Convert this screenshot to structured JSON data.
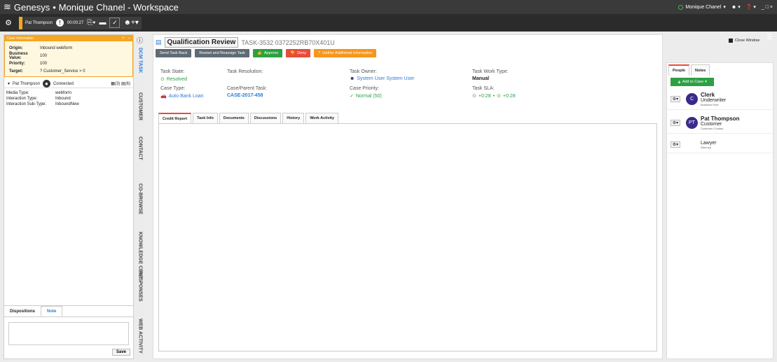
{
  "titlebar": {
    "brand": "Genesys",
    "separator": "•",
    "app_title": "Monique Chanel - Workspace",
    "agent_name": "Monique Chanel",
    "window_controls": "_ □ ×"
  },
  "toolbar": {
    "party_name": "Pat Thompson",
    "timer": "00:00:27"
  },
  "case_info": {
    "header": "Case Information",
    "fields": [
      {
        "k": "Origin:",
        "v": "Inbound webform"
      },
      {
        "k": "Business Value:",
        "v": "100"
      },
      {
        "k": "Priority:",
        "v": "100"
      },
      {
        "k": "Target:",
        "v": "? Customer_Service > 0"
      }
    ]
  },
  "party": {
    "name": "Pat Thompson",
    "status": "Connected",
    "count1": "(3)",
    "count2": "(6)"
  },
  "media": [
    {
      "k": "Media Type:",
      "v": "webform"
    },
    {
      "k": "Interaction Type:",
      "v": "Inbound"
    },
    {
      "k": "Interaction Sub-Type:",
      "v": "InboundNew"
    }
  ],
  "dispositions": {
    "tab1": "Dispositions",
    "tab2": "Note",
    "save": "Save"
  },
  "vtabs": [
    "DCM TASK",
    "CUSTOMER",
    "CONTACT",
    "CO-BROWSE",
    "KNOWLEDGE CENT",
    "RESPONSES",
    "WEB ACTIVITY"
  ],
  "main": {
    "title": "Qualification Review",
    "task_id": "TASK-3532 0372252RB70X401U",
    "close": "Close Window",
    "actions": {
      "send_back": "Send Task Back",
      "restart": "Restart and Reassign Task",
      "approve": "Approve",
      "deny": "Deny",
      "gather": "Gather Additional Information"
    },
    "fields": {
      "task_state_l": "Task State:",
      "task_state_v": "Resolved",
      "task_resolution_l": "Task Resolution:",
      "task_owner_l": "Task Owner:",
      "task_owner_v": "System User System User",
      "task_work_type_l": "Task Work Type:",
      "task_work_type_v": "Manual",
      "case_type_l": "Case Type:",
      "case_type_v": "Auto Bank Loan",
      "parent_task_l": "Case/Parent Task:",
      "parent_task_v": "CASE-2017-458",
      "case_priority_l": "Case Priority:",
      "case_priority_v": "Normal (50)",
      "task_sla_l": "Task SLA:",
      "sla_a": "+0:28",
      "sla_sep": "•",
      "sla_b": "+0:28"
    },
    "content_tabs": [
      "Credit Report",
      "Task Info",
      "Documents",
      "Discussions",
      "History",
      "Work Activity"
    ]
  },
  "right": {
    "tab_people": "People",
    "tab_notes": "Notes",
    "add_case": "Add to Case",
    "people": [
      {
        "initials": "C",
        "name": "Clerk",
        "role": "Underwriter",
        "sub": "Business Role"
      },
      {
        "initials": "PT",
        "name": "Pat Thompson",
        "role": "Customer",
        "sub": "Customer Contact"
      },
      {
        "initials": "",
        "name": "",
        "role": "Lawyer",
        "sub": "Attorney"
      }
    ]
  },
  "colors": {
    "accent": "#f5a623",
    "blue": "#2b7bd8",
    "green": "#2ea043",
    "red": "#e74c3c",
    "orange": "#f5961e"
  }
}
